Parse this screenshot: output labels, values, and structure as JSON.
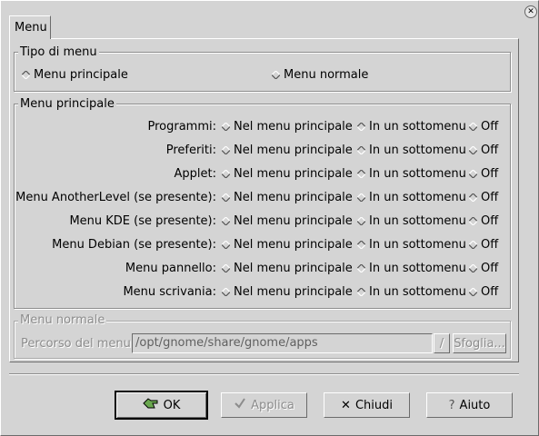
{
  "tab": {
    "label": "Menu"
  },
  "menu_type": {
    "legend": "Tipo di menu",
    "options": [
      {
        "label": "Menu principale",
        "selected": true
      },
      {
        "label": "Menu normale",
        "selected": false
      }
    ]
  },
  "main_menu": {
    "legend": "Menu principale",
    "option_labels": {
      "main": "Nel menu principale",
      "sub": "In un sottomenu",
      "off": "Off"
    },
    "rows": [
      {
        "label": "Programmi:",
        "selected": "sub"
      },
      {
        "label": "Preferiti:",
        "selected": "sub"
      },
      {
        "label": "Applet:",
        "selected": "sub"
      },
      {
        "label": "Menu AnotherLevel (se presente):",
        "selected": "off"
      },
      {
        "label": "Menu KDE (se presente):",
        "selected": "off"
      },
      {
        "label": "Menu Debian (se presente):",
        "selected": "sub"
      },
      {
        "label": "Menu pannello:",
        "selected": "sub"
      },
      {
        "label": "Menu scrivania:",
        "selected": "sub"
      }
    ]
  },
  "normal_menu": {
    "legend": "Menu normale",
    "path_label": "Percorso del menu",
    "path_value": "/opt/gnome/share/gnome/apps",
    "slash_button": "/",
    "browse_button": "Sfoglia..."
  },
  "buttons": {
    "ok": "OK",
    "apply": "Applica",
    "close": "Chiudi",
    "help": "Aiuto"
  }
}
